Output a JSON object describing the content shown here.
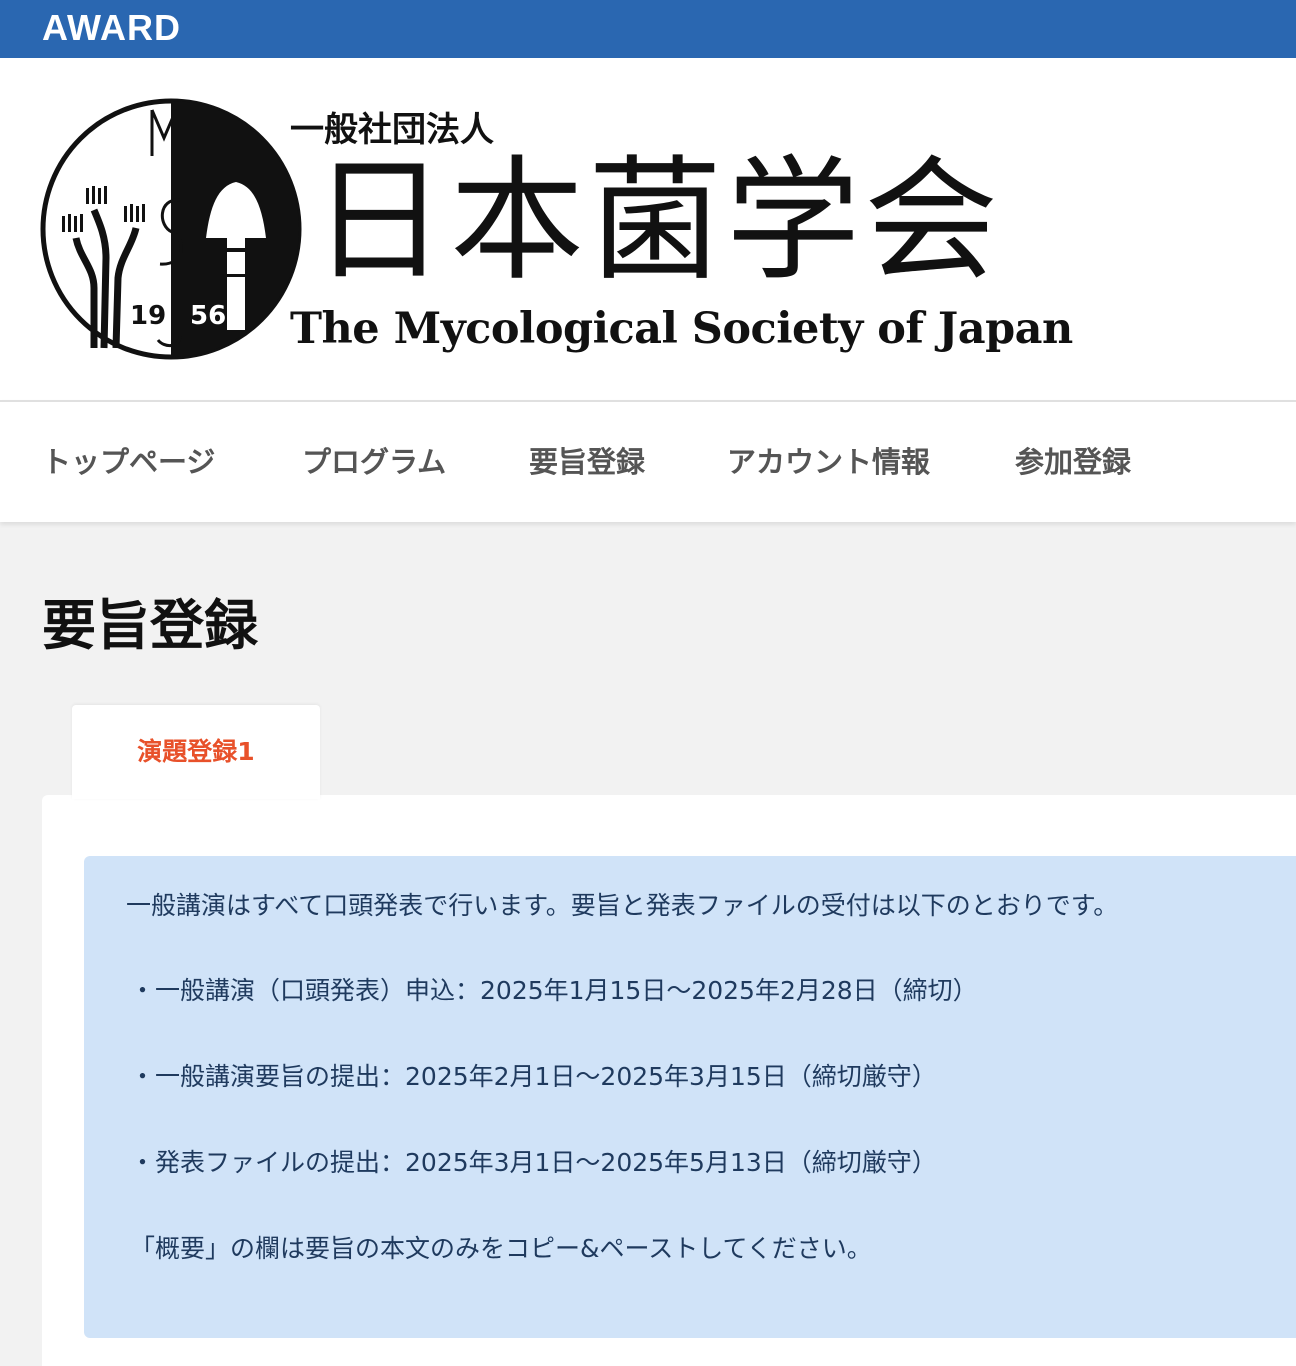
{
  "topbar": {
    "brand": "AWARD"
  },
  "header": {
    "emblem_year_left": "19",
    "emblem_year_right": "56",
    "org_type": "一般社団法人",
    "org_name_ja": "日本菌学会",
    "org_name_en": "The Mycological Society of Japan"
  },
  "nav": {
    "items": [
      {
        "label": "トップページ"
      },
      {
        "label": "プログラム"
      },
      {
        "label": "要旨登録"
      },
      {
        "label": "アカウント情報"
      },
      {
        "label": "参加登録"
      }
    ]
  },
  "main": {
    "title": "要旨登録",
    "tabs": [
      {
        "label": "演題登録1"
      }
    ],
    "notice": {
      "lines": [
        "一般講演はすべて口頭発表で行います。要旨と発表ファイルの受付は以下のとおりです。",
        "・一般講演（口頭発表）申込：2025年1月15日〜2025年2月28日（締切）",
        "・一般講演要旨の提出：2025年2月1日〜2025年3月15日（締切厳守）",
        "・発表ファイルの提出：2025年3月1日〜2025年5月13日（締切厳守）",
        "「概要」の欄は要旨の本文のみをコピー&ペーストしてください。"
      ]
    }
  },
  "colors": {
    "topbar": "#2a67b1",
    "tab_active_text": "#e8512a",
    "notice_bg": "#d0e3f8",
    "notice_text": "#1f3a5e"
  }
}
